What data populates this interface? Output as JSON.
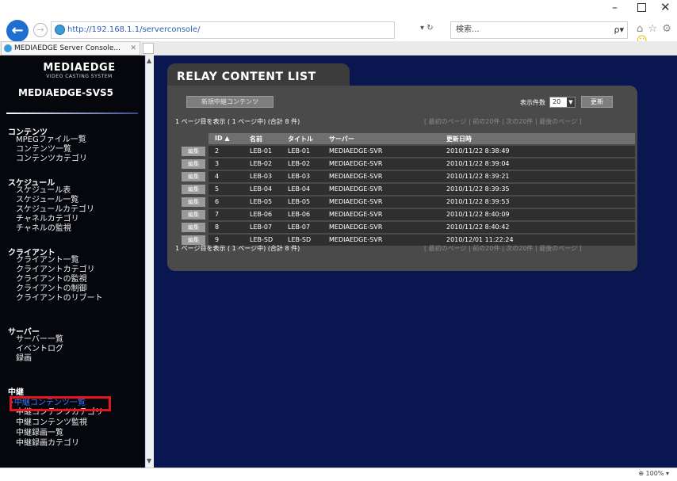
{
  "browser": {
    "url": "http://192.168.1.1/serverconsole/",
    "address_controls": "▾ ↻",
    "search_placeholder": "検索...",
    "search_icon": "ρ▾",
    "tab_title": "MEDIAEDGE Server Console...",
    "tab_close": "✕",
    "back_icon": "←",
    "forward_icon": "→",
    "window_min": "–",
    "window_close": "✕",
    "toolbar_home": "⌂",
    "toolbar_star": "☆",
    "toolbar_gear": "⚙",
    "toolbar_smiley": "☺",
    "zoom": "⊕ 100% ▾"
  },
  "sidebar": {
    "brand": "MEDIAEDGE",
    "tagline": "VIDEO CASTING SYSTEM",
    "server_name": "MEDIAEDGE-SVS5",
    "scroll_up": "▲",
    "scroll_down": "▼",
    "sections": [
      {
        "label": "コンテンツ",
        "items": [
          "MPEGファイル一覧",
          "コンテンツ一覧",
          "コンテンツカテゴリ"
        ]
      },
      {
        "label": "スケジュール",
        "items": [
          "スケジュール表",
          "スケジュール一覧",
          "スケジュールカテゴリ",
          "チャネルカテゴリ",
          "チャネルの監視"
        ]
      },
      {
        "label": "クライアント",
        "items": [
          "クライアント一覧",
          "クライアントカテゴリ",
          "クライアントの監視",
          "クライアントの制御",
          "クライアントのリブート"
        ]
      },
      {
        "label": "サーバー",
        "items": [
          "サーバー一覧",
          "イベントログ",
          "録画"
        ]
      },
      {
        "label": "中継",
        "items": [
          "•中継コンテンツ一覧",
          "中継コンテンツカテゴリ",
          "中継コンテンツ監視",
          "中継録画一覧",
          "中継録画カテゴリ"
        ]
      }
    ]
  },
  "content": {
    "title": "RELAY CONTENT LIST",
    "new_button": "新規中継コンテンツ",
    "per_page_label": "表示件数",
    "per_page_value": "20",
    "per_page_arrow": "▼",
    "update_button": "更新",
    "pager_left": "1 ページ目を表示 ( 1 ページ中) (合計 8 件)",
    "pager_right": "[ 最初のページ | 前の20件 | 次の20件 | 最後のページ ]",
    "columns": [
      "ID ▲",
      "名前",
      "タイトル",
      "サーバー",
      "更新日時"
    ],
    "edit_label": "編集",
    "rows": [
      {
        "id": "2",
        "name": "LEB-01",
        "title": "LEB-01",
        "server": "MEDIAEDGE-SVR",
        "date": "2010/11/22 8:38:49"
      },
      {
        "id": "3",
        "name": "LEB-02",
        "title": "LEB-02",
        "server": "MEDIAEDGE-SVR",
        "date": "2010/11/22 8:39:04"
      },
      {
        "id": "4",
        "name": "LEB-03",
        "title": "LEB-03",
        "server": "MEDIAEDGE-SVR",
        "date": "2010/11/22 8:39:21"
      },
      {
        "id": "5",
        "name": "LEB-04",
        "title": "LEB-04",
        "server": "MEDIAEDGE-SVR",
        "date": "2010/11/22 8:39:35"
      },
      {
        "id": "6",
        "name": "LEB-05",
        "title": "LEB-05",
        "server": "MEDIAEDGE-SVR",
        "date": "2010/11/22 8:39:53"
      },
      {
        "id": "7",
        "name": "LEB-06",
        "title": "LEB-06",
        "server": "MEDIAEDGE-SVR",
        "date": "2010/11/22 8:40:09"
      },
      {
        "id": "8",
        "name": "LEB-07",
        "title": "LEB-07",
        "server": "MEDIAEDGE-SVR",
        "date": "2010/11/22 8:40:42"
      },
      {
        "id": "9",
        "name": "LEB-SD",
        "title": "LEB-SD",
        "server": "MEDIAEDGE-SVR",
        "date": "2010/12/01 11:22:24"
      }
    ]
  },
  "colors": {
    "page_bg": "#0a1650",
    "sidebar_bg": "#05070d",
    "panel_bg": "#4a4a4a",
    "active_link": "#3b7dff",
    "highlight": "#e8141d"
  }
}
